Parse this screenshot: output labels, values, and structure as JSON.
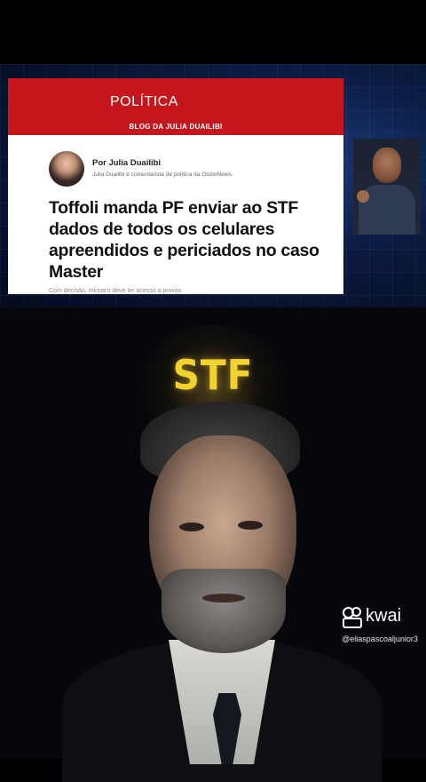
{
  "article": {
    "section": "POLÍTICA",
    "blog": "BLOG DA JULIA DUAILIBI",
    "byline": "Por Julia Duailibi",
    "byline_desc": "Julia Duailibi é comentarista de política da GloboNews.",
    "headline": "Toffoli manda PF enviar ao STF dados de todos os celulares apreendidos e periciados no caso Master",
    "subline": "Com decisão, ministro deve ter acesso a provas"
  },
  "overlay": {
    "stf": "STF",
    "brand": "kwai",
    "handle": "@eliaspascoaljunior3"
  },
  "colors": {
    "accent_red": "#c4161c",
    "stf_yellow": "#f2d22e"
  }
}
